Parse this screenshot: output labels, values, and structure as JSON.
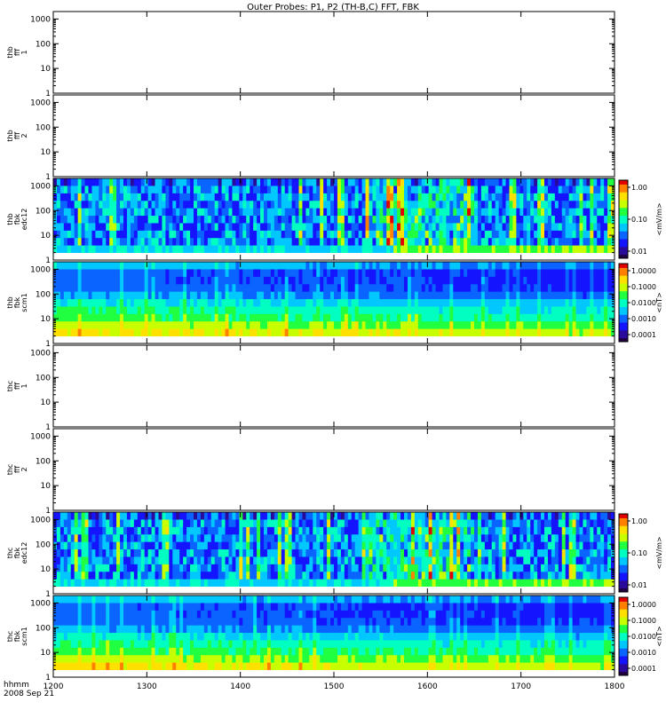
{
  "chart_data": {
    "type": "heatmap",
    "title": "Outer Probes: P1, P2 (TH-B,C) FFT, FBK",
    "xlabel_top": "hhmm",
    "xlabel_bottom": "2008 Sep 21",
    "xlim": [
      1200,
      1800
    ],
    "xticks": [
      "1200",
      "1300",
      "1400",
      "1500",
      "1600",
      "1700",
      "1800"
    ],
    "y_scale": "log",
    "ylim": [
      1,
      2000
    ],
    "yticks": [
      "1",
      "10",
      "100",
      "1000"
    ],
    "panels": [
      {
        "label_lines": [
          "thb",
          "fff",
          "1"
        ],
        "empty": true
      },
      {
        "label_lines": [
          "thb",
          "fff",
          "2"
        ],
        "empty": true
      },
      {
        "label_lines": [
          "thb",
          "fbk",
          "edc12"
        ],
        "empty": false,
        "colorbar": {
          "title": "<mV/m>",
          "ticks": [
            "1.00",
            "0.10",
            "0.01"
          ]
        }
      },
      {
        "label_lines": [
          "thb",
          "fbk",
          "scm1"
        ],
        "empty": false,
        "colorbar": {
          "title": "<nT>",
          "ticks": [
            "1.0000",
            "0.1000",
            "0.0100",
            "0.0010",
            "0.0001"
          ]
        }
      },
      {
        "label_lines": [
          "thc",
          "fff",
          "1"
        ],
        "empty": true
      },
      {
        "label_lines": [
          "thc",
          "fff",
          "2"
        ],
        "empty": true
      },
      {
        "label_lines": [
          "thc",
          "fbk",
          "edc12"
        ],
        "empty": false,
        "colorbar": {
          "title": "<mV/m>",
          "ticks": [
            "1.00",
            "0.10",
            "0.01"
          ]
        }
      },
      {
        "label_lines": [
          "thc",
          "fbk",
          "scm1"
        ],
        "empty": false,
        "colorbar": {
          "title": "<nT>",
          "ticks": [
            "1.0000",
            "0.1000",
            "0.0100",
            "0.0010",
            "0.0001"
          ]
        }
      }
    ],
    "legend": "colorbars at right of each spectrogram panel",
    "colormap": [
      "#200040",
      "#2a0a9a",
      "#1414ff",
      "#0a64ff",
      "#00c8ff",
      "#00ffc0",
      "#20ff40",
      "#c8ff00",
      "#ffe000",
      "#ff8000",
      "#e00000"
    ]
  }
}
